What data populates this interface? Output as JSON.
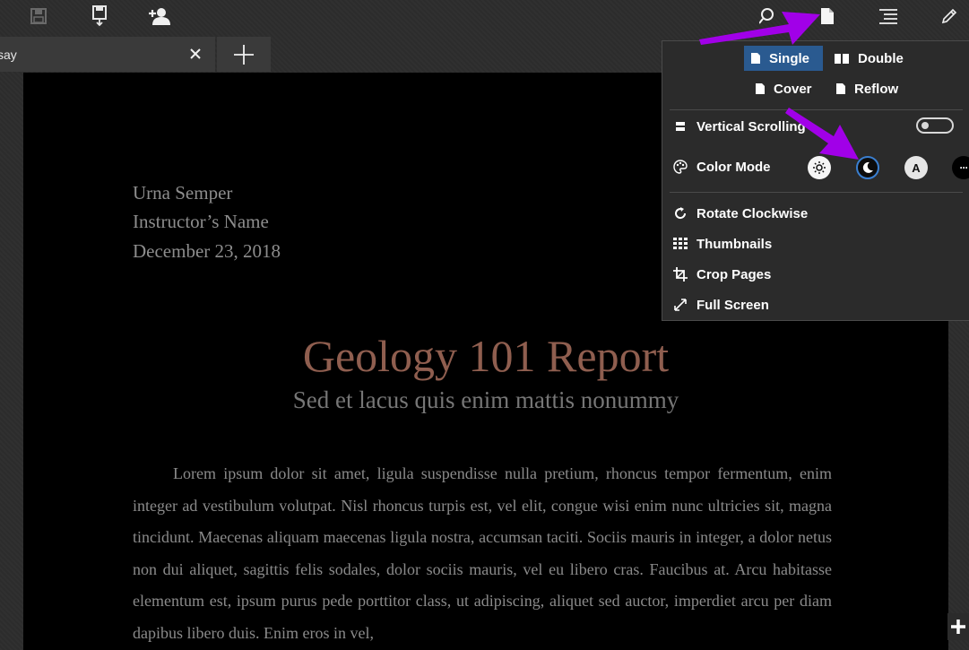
{
  "tab": {
    "label": "say"
  },
  "document": {
    "author": "Urna Semper",
    "instructor": "Instructor’s Name",
    "date": "December 23, 2018",
    "title": "Geology 101 Report",
    "subtitle": "Sed et lacus quis enim mattis nonummy",
    "body": "Lorem ipsum dolor sit amet, ligula suspendisse nulla pretium, rhoncus tempor fermentum, enim integer ad vestibulum volutpat. Nisl rhoncus turpis est, vel elit, congue wisi enim nunc ultricies sit, magna tincidunt. Maecenas aliquam maecenas ligula nostra, accumsan taciti. Sociis mauris in integer, a dolor netus non dui aliquet, sagittis felis sodales, dolor sociis mauris, vel eu libero cras. Faucibus at. Arcu habitasse elementum est, ipsum purus pede porttitor class, ut adipiscing, aliquet sed auctor, imperdiet arcu per diam dapibus libero duis. Enim eros in vel,"
  },
  "menu": {
    "layout": {
      "single": "Single",
      "double": "Double",
      "cover": "Cover",
      "reflow": "Reflow",
      "selected": "Single"
    },
    "vertical_scrolling": {
      "label": "Vertical Scrolling",
      "on": false
    },
    "color_mode": {
      "label": "Color Mode",
      "modes": [
        "light-mode-icon",
        "dark-mode-icon",
        "auto-mode-icon",
        "more-icon"
      ],
      "selected": "dark-mode-icon",
      "auto_letter": "A",
      "more_label": "···"
    },
    "rotate": "Rotate Clockwise",
    "thumbnails": "Thumbnails",
    "crop": "Crop Pages",
    "fullscreen": "Full Screen"
  },
  "colors": {
    "accent": "#2a5a90",
    "title": "#8f5e4f",
    "arrow": "#a100e8"
  }
}
